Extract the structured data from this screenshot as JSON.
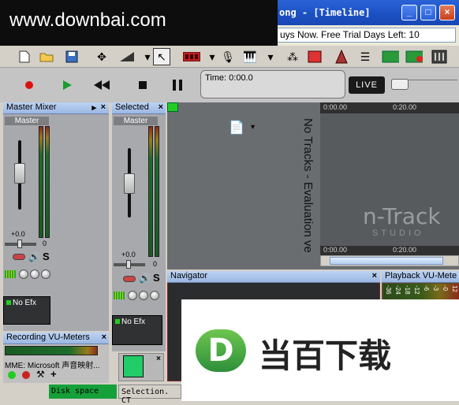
{
  "window": {
    "title": "ong - [Timeline]",
    "trial_text": "uys Now. Free Trial Days Left: 10"
  },
  "watermark": {
    "text": "www.downbai.com"
  },
  "transport": {
    "time_label": "Time: 0:00.0",
    "live_label": "LIVE"
  },
  "panels": {
    "master_mixer": {
      "title": "Master Mixer",
      "channel_label": "Master",
      "fader_value": "+0.0",
      "pan_value": "0",
      "solo": "S",
      "efx": "No Efx"
    },
    "selected": {
      "title": "Selected",
      "channel_label": "Master",
      "fader_value": "+0.0",
      "pan_value": "0",
      "solo": "S",
      "efx": "No Efx"
    },
    "recording_vu": {
      "title": "Recording VU-Meters",
      "device": "MME: Microsoft 声音映射..."
    },
    "navigator": {
      "title": "Navigator"
    },
    "playback_vu": {
      "title": "Playback VU-Mete",
      "scale": [
        "-36",
        "-24",
        "-18",
        "-12",
        "-6",
        "-3",
        "-0",
        "12"
      ]
    }
  },
  "timeline": {
    "ruler_top": [
      "0:00.00",
      "0:20.00"
    ],
    "ruler_bottom": [
      "0:00.00",
      "0:20.00"
    ],
    "vertical_text": "No Tracks - Evaluation ve",
    "brand": "n-Track",
    "brand_sub": "STUDIO"
  },
  "statusbar": {
    "disk": "Disk space",
    "selection": "Selection. CT"
  },
  "ad": {
    "logo_letter": "D",
    "text": "当百下载"
  },
  "colors": {
    "titlebar": "#1b4fc2",
    "accent_green": "#16a03a",
    "nav_border": "#8a1f1f"
  }
}
